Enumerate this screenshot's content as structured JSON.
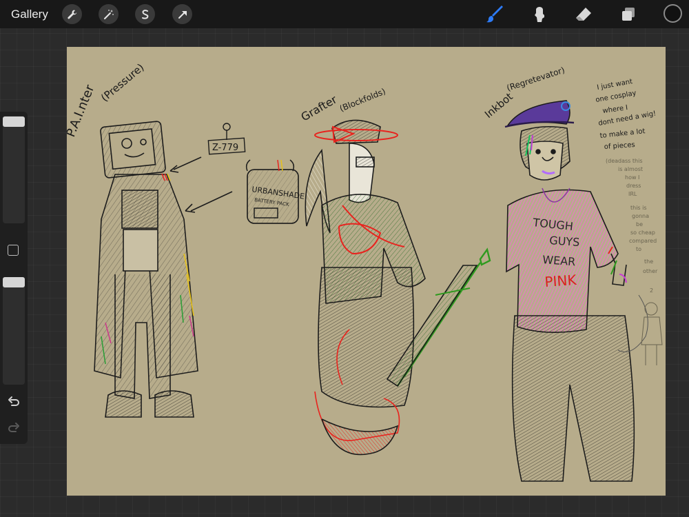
{
  "topbar": {
    "gallery_label": "Gallery",
    "actions": [
      "wrench-icon",
      "magic-wand-icon",
      "selection-icon",
      "transform-arrow-icon"
    ],
    "tools": [
      "brush-icon",
      "smudge-icon",
      "eraser-icon",
      "layers-icon"
    ],
    "active_tool": "brush-icon",
    "active_tool_color": "#2d7bf6",
    "current_color": "#111111"
  },
  "sidebar": {
    "controls": [
      "brush-size-slider",
      "modify-button",
      "opacity-slider",
      "undo-icon",
      "redo-icon"
    ]
  },
  "canvas": {
    "background": "#b7ac8b",
    "sketch_labels": {
      "char1_name": "P.A.I.nter",
      "char1_game": "(Pressure)",
      "tag": "Z-779",
      "battery_line1": "URBANSHADE",
      "battery_line2": "BATTERY PACK",
      "char2_name": "Grafter",
      "char2_game": "(Blockfolds)",
      "char3_name": "Inkbot",
      "char3_game": "(Regretevator)",
      "note_line1": "I just want",
      "note_line2": "one cosplay",
      "note_line3": "where I",
      "note_line4": "dont need a wig!",
      "note_line5": "to make a lot",
      "note_line6": "of pieces",
      "note2_line1": "(deadass this",
      "note2_line2": "is almost",
      "note2_line3": "how I",
      "note2_line4": "dress",
      "note2_line5": "IRL",
      "note3_line1": "this is",
      "note3_line2": "gonna",
      "note3_line3": "be",
      "note3_line4": "so cheap",
      "note3_line5": "compared",
      "note3_line6": "to",
      "note3_line7": "the",
      "note3_line8": "other",
      "note3_line9": "2",
      "shirt_line1": "TOUGH",
      "shirt_line2": "GUYS",
      "shirt_line3": "WEAR",
      "shirt_line4": "PINK"
    }
  }
}
